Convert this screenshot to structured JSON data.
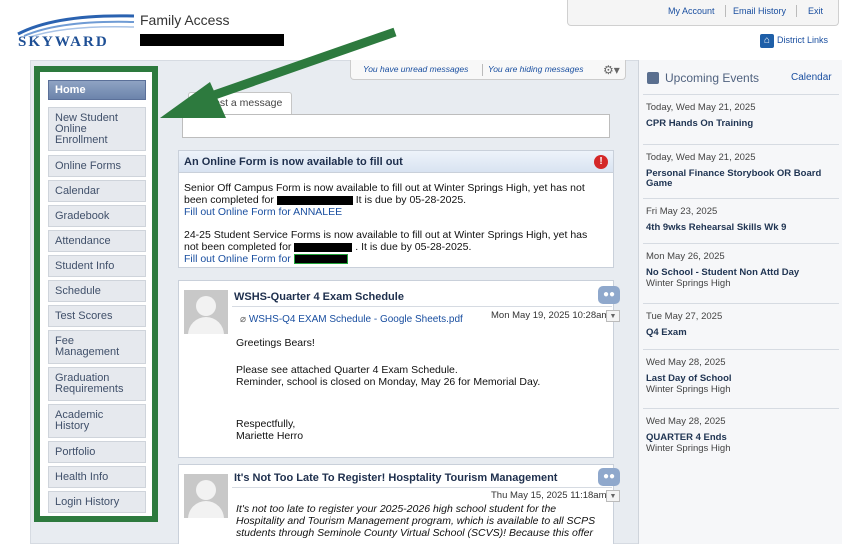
{
  "header": {
    "app_name": "Family Access",
    "logo_text": "SKYWARD",
    "links": [
      "My Account",
      "Email History",
      "Exit"
    ],
    "district_links": "District Links"
  },
  "sidebar": {
    "items": [
      {
        "label": "Home",
        "active": true
      },
      {
        "label": "New Student Online Enrollment"
      },
      {
        "label": "Online Forms"
      },
      {
        "label": "Calendar"
      },
      {
        "label": "Gradebook"
      },
      {
        "label": "Attendance"
      },
      {
        "label": "Student Info"
      },
      {
        "label": "Schedule"
      },
      {
        "label": "Test Scores"
      },
      {
        "label": "Fee Management"
      },
      {
        "label": "Graduation Requirements"
      },
      {
        "label": "Academic History"
      },
      {
        "label": "Portfolio"
      },
      {
        "label": "Health Info"
      },
      {
        "label": "Login History"
      }
    ]
  },
  "messages": {
    "unread": "You have unread messages",
    "hiding": "You are hiding messages"
  },
  "post": {
    "tab_label": "Post a message"
  },
  "online_form": {
    "title": "An Online Form is now available to fill out",
    "line1a": "Senior Off Campus Form is now available to fill out at Winter Springs High, yet has not",
    "line1b_pre": "been completed for",
    "line1b_post": "It is due by 05-28-2025.",
    "link1": "Fill out Online Form for ANNALEE",
    "line2a": "24-25 Student Service Forms is now available to fill out at Winter Springs High, yet has",
    "line2b_pre": "not been completed for",
    "line2b_post": ". It is due by 05-28-2025.",
    "link2": "Fill out Online Form for"
  },
  "posts": [
    {
      "title": "WSHS-Quarter 4 Exam Schedule",
      "attachment": "WSHS-Q4 EXAM Schedule - Google Sheets.pdf",
      "date": "Mon May 19, 2025 10:28am",
      "greeting": "Greetings Bears!",
      "body1": "Please see attached Quarter 4 Exam Schedule.",
      "body2": "Reminder, school is closed on Monday, May 26 for Memorial Day.",
      "sign1": "Respectfully,",
      "sign2": "Mariette Herro"
    },
    {
      "title": "It's Not Too Late To Register! Hosptality Tourism Management",
      "date": "Thu May 15, 2025 11:18am",
      "body1": "It's not too late to register your 2025-2026 high school student for the",
      "body2": "Hospitality and Tourism Management program, which is available to all SCPS",
      "body3": "students through Seminole County Virtual School (SCVS)!  Because this offer"
    }
  ],
  "events": {
    "title": "Upcoming Events",
    "calendar_link": "Calendar",
    "items": [
      {
        "date": "Today, Wed May 21, 2025",
        "title": "CPR Hands On Training",
        "sub": ""
      },
      {
        "date": "Today, Wed May 21, 2025",
        "title": "Personal Finance Storybook OR Board Game",
        "sub": ""
      },
      {
        "date": "Fri May 23, 2025",
        "title": "4th 9wks Rehearsal Skills Wk 9",
        "sub": ""
      },
      {
        "date": "Mon May 26, 2025",
        "title": "No School - Student Non Attd Day",
        "sub": "Winter Springs High"
      },
      {
        "date": "Tue May 27, 2025",
        "title": "Q4 Exam",
        "sub": ""
      },
      {
        "date": "Wed May 28, 2025",
        "title": "Last Day of School",
        "sub": "Winter Springs High"
      },
      {
        "date": "Wed May 28, 2025",
        "title": "QUARTER 4 Ends",
        "sub": "Winter Springs High"
      }
    ]
  },
  "colors": {
    "highlight_box": "#2d7a3e",
    "arrow": "#2d7a3e",
    "link": "#1a4fa0"
  }
}
